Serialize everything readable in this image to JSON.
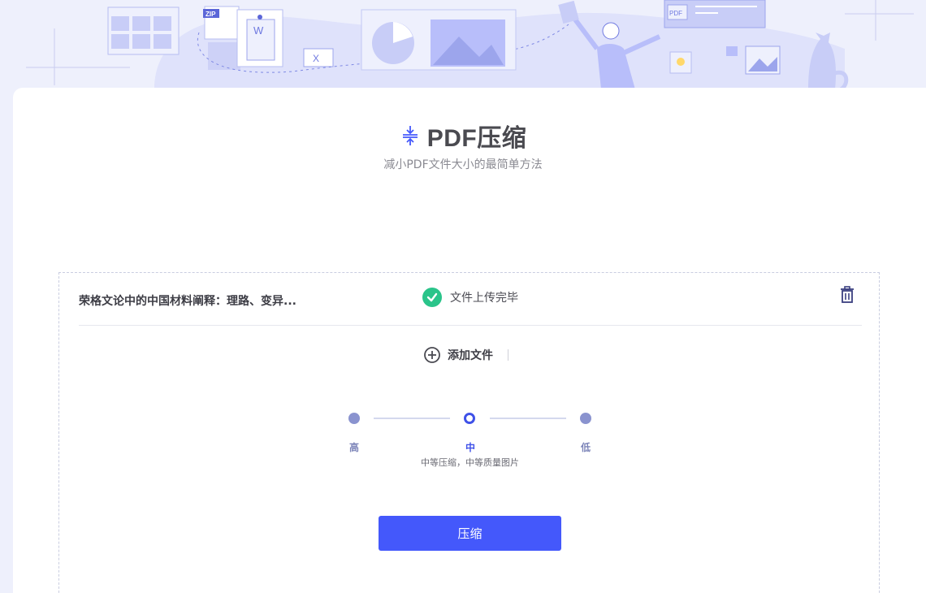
{
  "header": {
    "title": "PDF压缩",
    "subtitle": "减小PDF文件大小的最简单方法",
    "title_icon": "compress-icon"
  },
  "banner": {
    "zip_label": "ZIP",
    "word_label": "W",
    "excel_label": "X",
    "pdf_label": "PDF"
  },
  "file": {
    "name": "荣格文论中的中国材料阐释：理路、变异...",
    "status": "文件上传完毕",
    "status_icon": "check-circle-icon",
    "delete_icon": "trash-icon"
  },
  "add_file": {
    "label": "添加文件",
    "icon": "plus-circle-icon"
  },
  "compression": {
    "levels": [
      "高",
      "中",
      "低"
    ],
    "selected": "中",
    "description": "中等压缩，中等质量图片"
  },
  "actions": {
    "compress_label": "压缩"
  },
  "colors": {
    "accent": "#4458fb",
    "success": "#2ac48a",
    "banner_bg": "#eef0fc",
    "illustration": "#9ca5ec"
  }
}
